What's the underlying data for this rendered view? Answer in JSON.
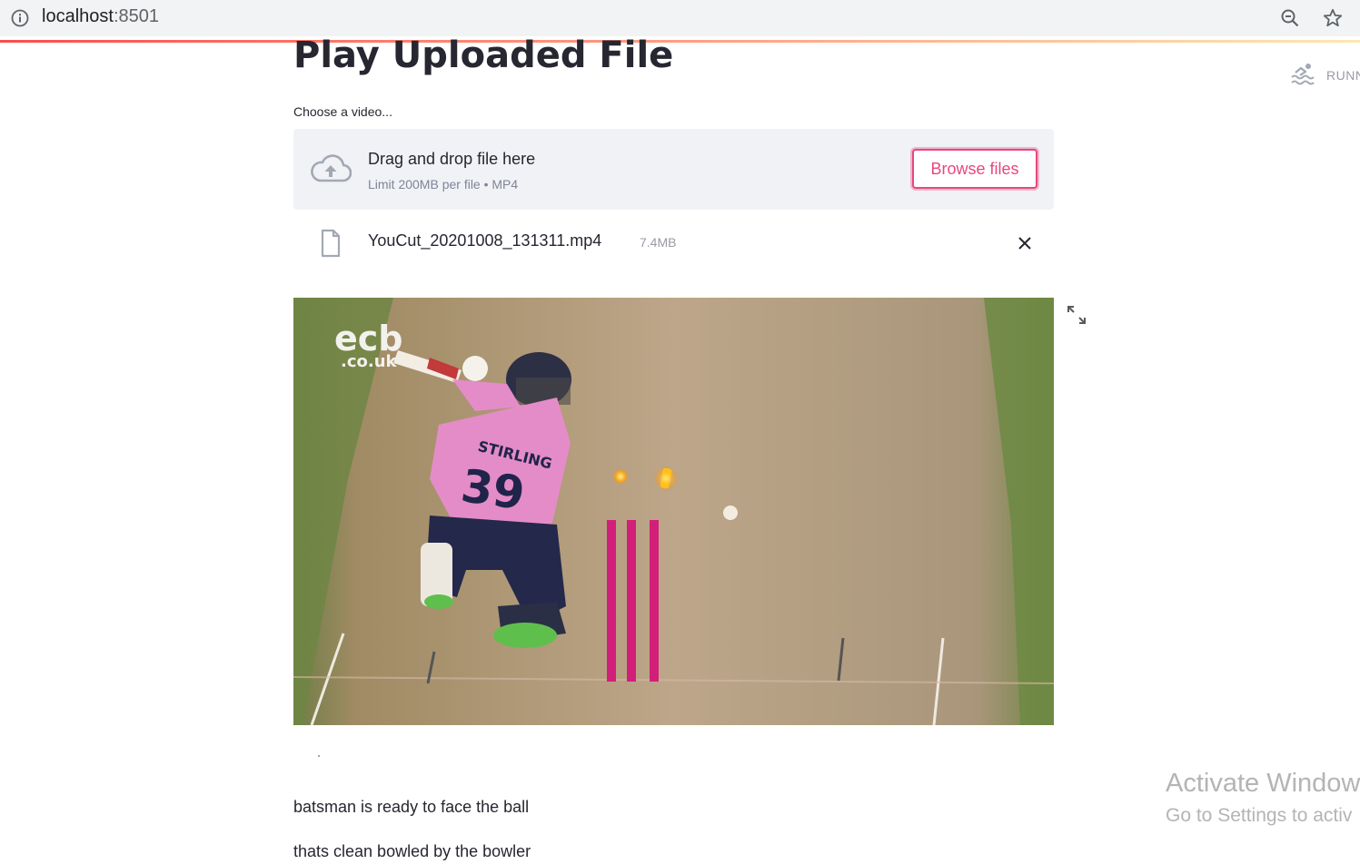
{
  "browser": {
    "url_host": "localhost",
    "url_port": ":8501"
  },
  "status": {
    "text": "RUNN"
  },
  "main": {
    "title": "Play Uploaded File",
    "uploader": {
      "label": "Choose a video...",
      "drop_title": "Drag and drop file here",
      "limit_text": "Limit 200MB per file • MP4",
      "browse_label": "Browse files"
    },
    "file": {
      "name": "YouCut_20201008_131311.mp4",
      "size": "7.4MB"
    },
    "video": {
      "logo_main": "ecb",
      "logo_sub": ".co.uk",
      "player_name": "STIRLING",
      "player_number": "39"
    },
    "captions": [
      "batsman is ready to face the ball",
      "thats clean bowled by the bowler"
    ]
  },
  "watermark": {
    "title": "Activate Window",
    "subtitle": "Go to Settings to activ"
  },
  "colors": {
    "accent": "#e8487c",
    "dropzone_bg": "#f0f2f6",
    "text": "#262730"
  }
}
